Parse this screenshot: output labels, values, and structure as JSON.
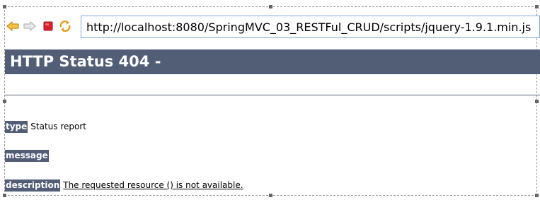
{
  "browser": {
    "back_icon": "back-arrow-icon",
    "forward_icon": "forward-arrow-icon",
    "stop_icon": "stop-icon",
    "refresh_icon": "refresh-icon",
    "url": "http://localhost:8080/SpringMVC_03_RESTFul_CRUD/scripts/jquery-1.9.1.min.js"
  },
  "page": {
    "title": "HTTP Status 404 -",
    "rows": [
      {
        "label": "type",
        "value": "Status report"
      },
      {
        "label": "message",
        "value": ""
      },
      {
        "label": "description",
        "value": "The requested resource () is not available."
      }
    ]
  },
  "colors": {
    "header_bg": "#525d76",
    "address_border": "#7ba7d9",
    "back_arrow": "#e0a020",
    "stop": "#d8202a"
  }
}
